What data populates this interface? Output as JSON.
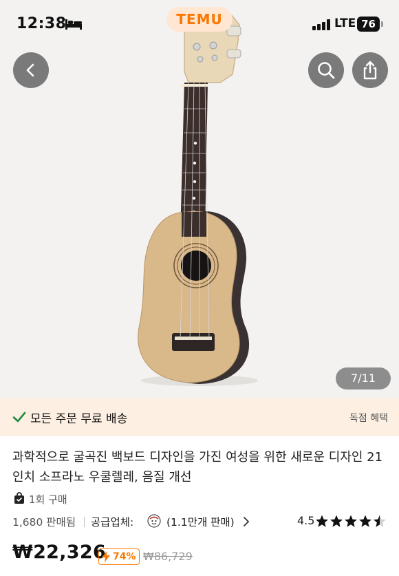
{
  "status_bar": {
    "time": "12:38",
    "network": "LTE",
    "battery": "76"
  },
  "brand": {
    "logo_text": "TEMU",
    "accent": "#fb7701"
  },
  "gallery": {
    "counter": "7/11"
  },
  "icons": {
    "back": "chevron-left-icon",
    "search": "search-icon",
    "share": "share-icon",
    "check": "check-icon",
    "bag": "bag-icon",
    "chevron": "chevron-right-icon",
    "star": "star-icon",
    "bolt": "lightning-icon"
  },
  "promo": {
    "left_text": "모든 주문 무료 배송",
    "right_text": "독점 혜택"
  },
  "product": {
    "title": "과학적으로 굴곡진 백보드 디자인을 가진 여성을 위한 새로운 디자인 21인치 소프라노 우쿨렐레, 음질 개선",
    "purchases": "1회 구매",
    "sold": "1,680 판매됨",
    "supplier_label": "공급업체:",
    "supplier_sales": "(1.1만개 판매)",
    "rating": "4.5",
    "rating_value": 4.5,
    "price": "₩22,326",
    "discount": "74%",
    "original_price": "₩86,729"
  }
}
